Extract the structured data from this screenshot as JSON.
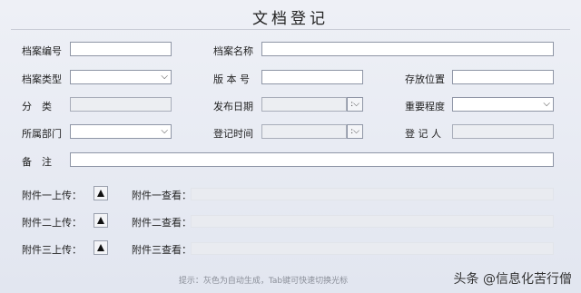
{
  "title": "文档登记",
  "labels": {
    "archive_no": "档案编号",
    "archive_name": "档案名称",
    "archive_type": "档案类型",
    "version": "版 本 号",
    "storage": "存放位置",
    "category": "分　类",
    "publish_date": "发布日期",
    "importance": "重要程度",
    "department": "所属部门",
    "reg_time": "登记时间",
    "registrant": "登 记 人",
    "remark": "备　注"
  },
  "attachments": [
    {
      "upload_label": "附件一上传：",
      "view_label": "附件一查看："
    },
    {
      "upload_label": "附件二上传：",
      "view_label": "附件二查看："
    },
    {
      "upload_label": "附件三上传：",
      "view_label": "附件三查看："
    }
  ],
  "hint": "提示：灰色为自动生成，Tab键可快速切换光标",
  "watermark": "头条 @信息化苦行僧",
  "icons": {
    "dropdown": "chevron-down-icon",
    "upload": "upload-triangle-icon"
  }
}
